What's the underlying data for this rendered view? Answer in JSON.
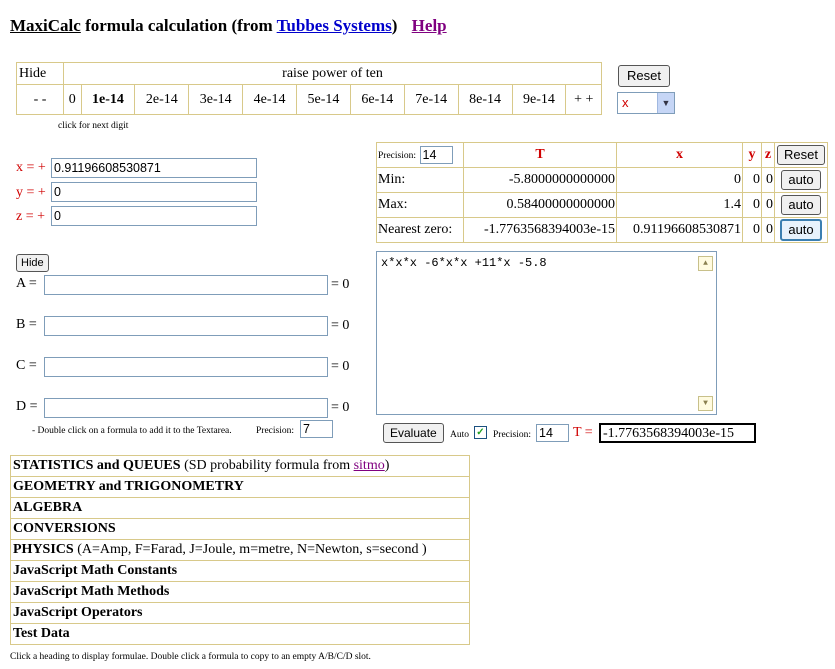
{
  "header": {
    "app_name": "MaxiCalc",
    "title_mid": "formula calculation (from",
    "vendor_link": "Tubbes Systems",
    "title_end": ")",
    "help_link": "Help"
  },
  "power_table": {
    "hide_label": "Hide",
    "caption": "raise power of ten",
    "minus_label": "- -",
    "plus_label": "+ +",
    "cells": [
      "0",
      "1e-14",
      "2e-14",
      "3e-14",
      "4e-14",
      "5e-14",
      "6e-14",
      "7e-14",
      "8e-14",
      "9e-14"
    ],
    "hint": "click for next digit"
  },
  "top_controls": {
    "reset_label": "Reset",
    "var_select_value": "x"
  },
  "variables": [
    {
      "label": "x = +",
      "value": "0.91196608530871"
    },
    {
      "label": "y = +",
      "value": "0"
    },
    {
      "label": "z = +",
      "value": "0"
    }
  ],
  "range_table": {
    "precision_label": "Precision:",
    "precision_value": "14",
    "col_t": "T",
    "col_x": "x",
    "col_y": "y",
    "col_z": "z",
    "reset_label": "Reset",
    "rows": [
      {
        "label": "Min:",
        "t": "-5.8000000000000",
        "x": "0",
        "y": "0",
        "z": "0",
        "btn": "auto"
      },
      {
        "label": "Max:",
        "t": "0.58400000000000",
        "x": "1.4",
        "y": "0",
        "z": "0",
        "btn": "auto"
      },
      {
        "label": "Nearest zero:",
        "t": "-1.7763568394003e-15",
        "x": "0.91196608530871",
        "y": "0",
        "z": "0",
        "btn": "auto"
      }
    ]
  },
  "slots": {
    "hide_label": "Hide",
    "items": [
      {
        "label": "A =",
        "value": "",
        "result": "= 0"
      },
      {
        "label": "B =",
        "value": "",
        "result": "= 0"
      },
      {
        "label": "C =",
        "value": "",
        "result": "= 0"
      },
      {
        "label": "D =",
        "value": "",
        "result": "= 0"
      }
    ],
    "note": "- Double click on a formula to add it to the Textarea.",
    "precision_label": "Precision:",
    "precision_value": "7"
  },
  "formula": {
    "text": "x*x*x -6*x*x +11*x -5.8"
  },
  "evaluate": {
    "button_label": "Evaluate",
    "auto_label": "Auto",
    "auto_checked": true,
    "precision_label": "Precision:",
    "precision_value": "14",
    "result_label": "T =",
    "result_value": "-1.7763568394003e-15"
  },
  "categories": {
    "items": [
      {
        "title": "STATISTICS and QUEUES",
        "suffix": " (SD probability formula from ",
        "link": "sitmo",
        "end": ")"
      },
      {
        "title": "GEOMETRY and TRIGONOMETRY"
      },
      {
        "title": "ALGEBRA"
      },
      {
        "title": "CONVERSIONS"
      },
      {
        "title": "PHYSICS",
        "suffix": " (A=Amp, F=Farad, J=Joule, m=metre, N=Newton, s=second )"
      },
      {
        "title": "JavaScript Math Constants"
      },
      {
        "title": "JavaScript Math Methods"
      },
      {
        "title": "JavaScript Operators"
      },
      {
        "title": "Test Data"
      }
    ],
    "footer_note": "Click a heading to display formulae. Double click a formula to copy to an empty A/B/C/D slot."
  }
}
